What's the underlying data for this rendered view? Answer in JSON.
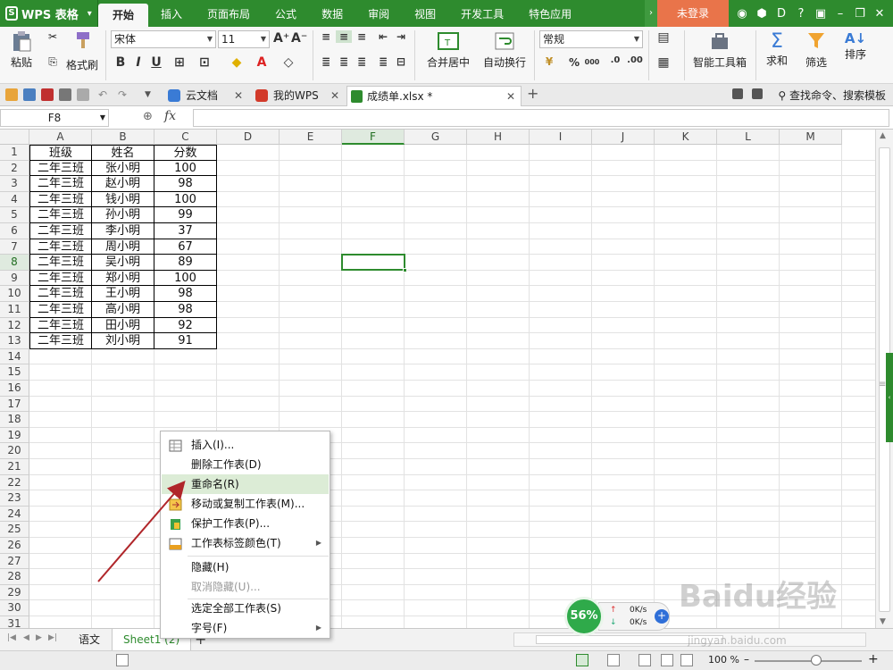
{
  "app": {
    "brand": "WPS 表格",
    "login": "未登录"
  },
  "menu_tabs": [
    "开始",
    "插入",
    "页面布局",
    "公式",
    "数据",
    "审阅",
    "视图",
    "开发工具",
    "特色应用"
  ],
  "ribbon": {
    "paste": "粘贴",
    "format_painter": "格式刷",
    "font_name": "宋体",
    "font_size": "11",
    "merge_center": "合并居中",
    "auto_wrap": "自动换行",
    "number_format": "常规",
    "percent": "%",
    "thousands": "000",
    "smart_toolbox": "智能工具箱",
    "sum": "求和",
    "filter": "筛选",
    "sort": "排序"
  },
  "doc_tabs": [
    "云文档",
    "我的WPS",
    "成绩单.xlsx *"
  ],
  "search_placeholder": "查找命令、搜索模板",
  "formula_bar": {
    "name_box": "F8",
    "fx": "fx"
  },
  "columns": [
    "A",
    "B",
    "C",
    "D",
    "E",
    "F",
    "G",
    "H",
    "I",
    "J",
    "K",
    "L",
    "M"
  ],
  "rows": [
    "1",
    "2",
    "3",
    "4",
    "5",
    "6",
    "7",
    "8",
    "9",
    "10",
    "11",
    "12",
    "13",
    "14",
    "15",
    "16",
    "17",
    "18",
    "19",
    "20",
    "21",
    "22",
    "23",
    "24",
    "25",
    "26",
    "27",
    "28",
    "29",
    "30",
    "31"
  ],
  "table": {
    "headers": [
      "班级",
      "姓名",
      "分数"
    ],
    "rows": [
      [
        "二年三班",
        "张小明",
        "100"
      ],
      [
        "二年三班",
        "赵小明",
        "98"
      ],
      [
        "二年三班",
        "钱小明",
        "100"
      ],
      [
        "二年三班",
        "孙小明",
        "99"
      ],
      [
        "二年三班",
        "李小明",
        "37"
      ],
      [
        "二年三班",
        "周小明",
        "67"
      ],
      [
        "二年三班",
        "吴小明",
        "89"
      ],
      [
        "二年三班",
        "郑小明",
        "100"
      ],
      [
        "二年三班",
        "王小明",
        "98"
      ],
      [
        "二年三班",
        "高小明",
        "98"
      ],
      [
        "二年三班",
        "田小明",
        "92"
      ],
      [
        "二年三班",
        "刘小明",
        "91"
      ]
    ]
  },
  "context_menu": [
    {
      "label": "插入(I)...",
      "disabled": false
    },
    {
      "label": "删除工作表(D)",
      "disabled": false
    },
    {
      "label": "重命名(R)",
      "disabled": false,
      "highlighted": true
    },
    {
      "label": "移动或复制工作表(M)...",
      "disabled": false
    },
    {
      "label": "保护工作表(P)...",
      "disabled": false
    },
    {
      "label": "工作表标签颜色(T)",
      "disabled": false,
      "submenu": true
    },
    {
      "label": "隐藏(H)",
      "disabled": false
    },
    {
      "label": "取消隐藏(U)...",
      "disabled": true
    },
    {
      "label": "选定全部工作表(S)",
      "disabled": false
    },
    {
      "label": "字号(F)",
      "disabled": false,
      "submenu": true
    }
  ],
  "sheet_tabs": [
    "语文",
    "Sheet1 (2)"
  ],
  "status": {
    "zoom": "100 %"
  },
  "speed_widget": {
    "percent": "56%",
    "up": "0K/s",
    "down": "0K/s"
  },
  "watermark": {
    "text": "Baidu经验",
    "url": "jingyan.baidu.com"
  },
  "colors": {
    "accent": "#2e8b2e",
    "login_bg": "#e9744a",
    "menu_highlight": "#dcecd6",
    "arrow": "#b0262a"
  }
}
